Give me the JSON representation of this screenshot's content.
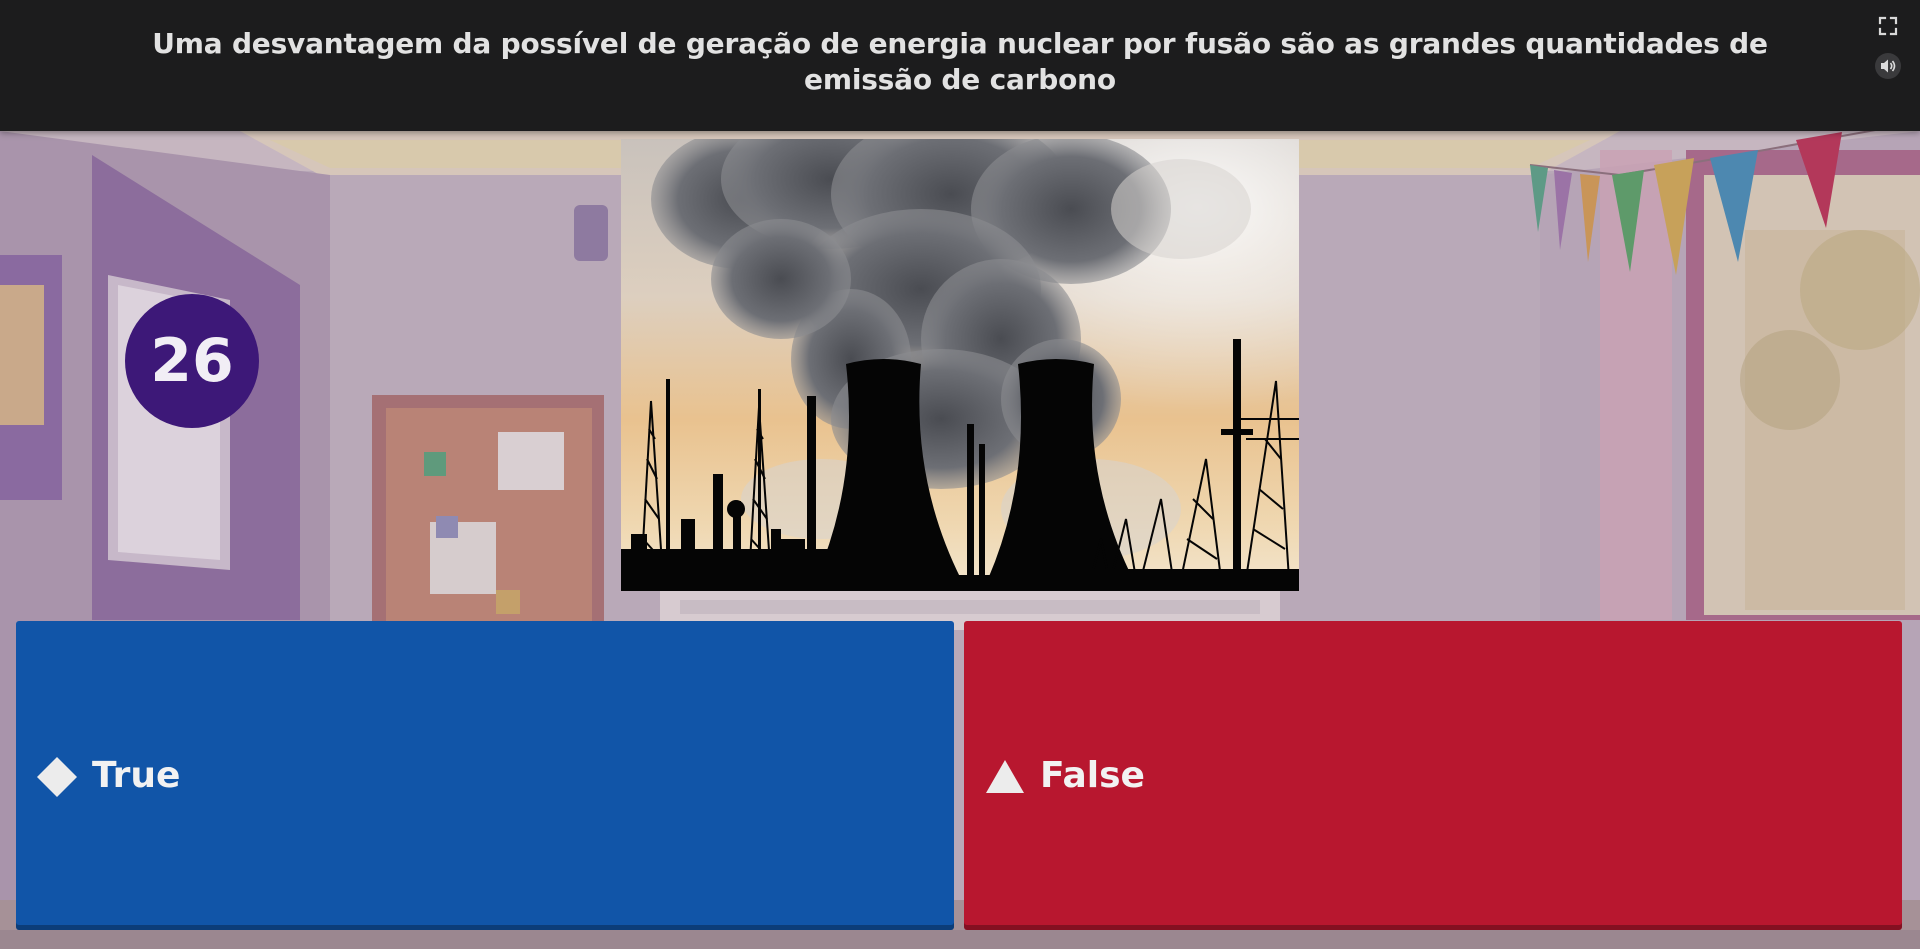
{
  "question": {
    "text": "Uma desvantagem da possível de geração de energia nuclear por fusão são as grandes quantidades de emissão de carbono"
  },
  "header": {
    "fullscreen_icon": "fullscreen-icon",
    "sound_icon": "speaker-icon"
  },
  "timer": {
    "value": "26"
  },
  "image": {
    "subject": "cooling-towers-smoke"
  },
  "answers": [
    {
      "label": "True",
      "shape": "diamond-icon",
      "color": "#1155a8"
    },
    {
      "label": "False",
      "shape": "triangle-icon",
      "color": "#b8172f"
    }
  ],
  "colors": {
    "header_bg": "#1c1c1d",
    "timer_bg": "#3d1878"
  }
}
